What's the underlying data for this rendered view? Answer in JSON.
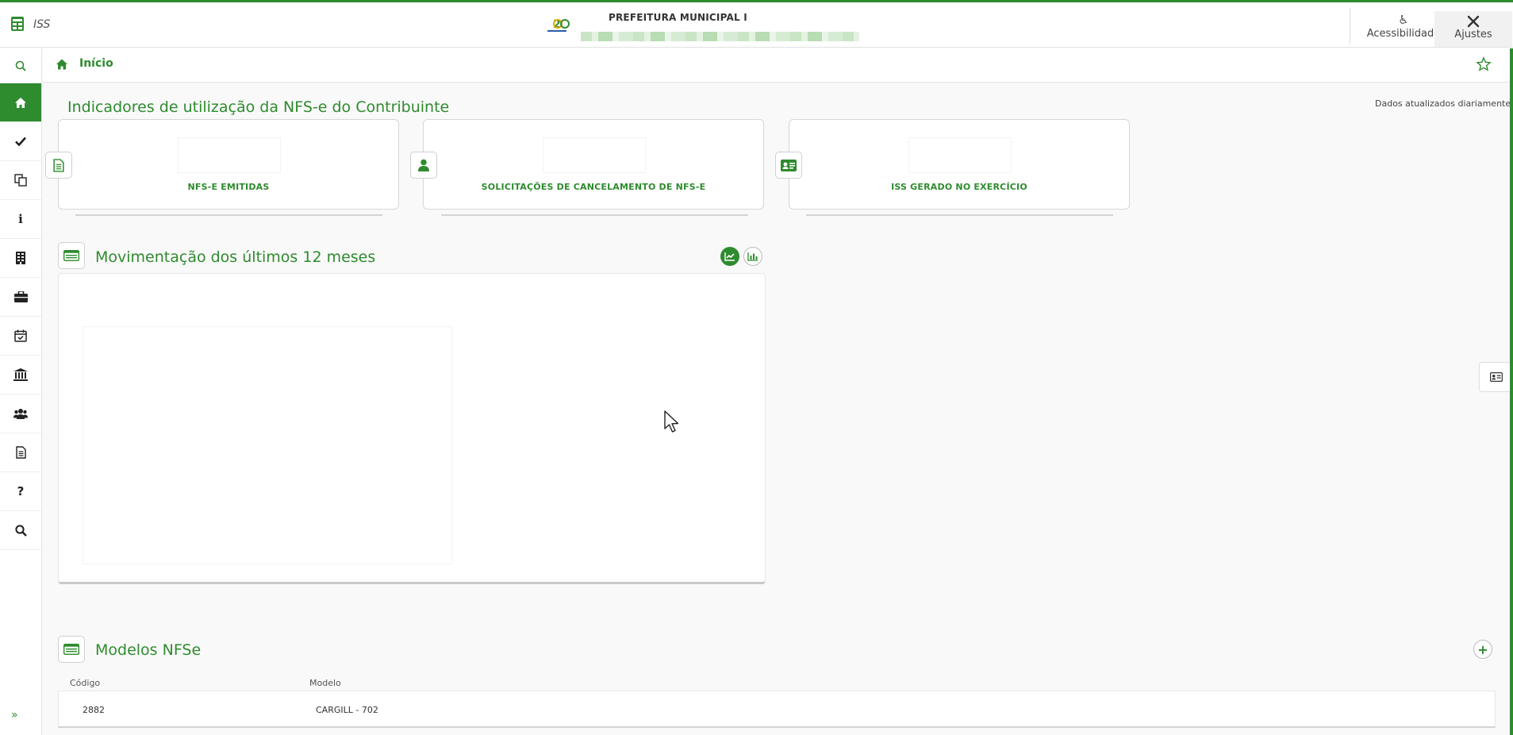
{
  "header": {
    "app_name": "ISS",
    "city_title": "PREFEITURA MUNICIPAL I",
    "accessibility_label": "Acessibilidade",
    "settings_label": "Ajustes"
  },
  "breadcrumb": {
    "home_label": "Início"
  },
  "indicators": {
    "title": "Indicadores de utilização da NFS-e do Contribuinte",
    "updated_note": "Dados atualizados diariamente",
    "cards": [
      {
        "label": "NFS-E EMITIDAS",
        "icon": "document-icon"
      },
      {
        "label": "SOLICITAÇÕES DE CANCELAMENTO DE NFS-E",
        "icon": "user-icon"
      },
      {
        "label": "ISS GERADO NO EXERCÍCIO",
        "icon": "id-card-icon"
      }
    ]
  },
  "movement": {
    "title": "Movimentação dos últimos 12 meses"
  },
  "models": {
    "title": "Modelos NFSe",
    "columns": [
      "Código",
      "Modelo"
    ],
    "rows": [
      {
        "codigo": "2882",
        "modelo": "CARGILL - 702"
      }
    ]
  },
  "colors": {
    "accent": "#2e8b2e"
  }
}
